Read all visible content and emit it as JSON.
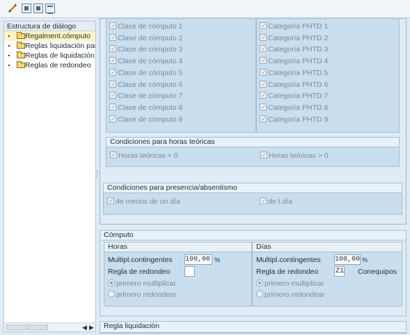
{
  "toolbar": {
    "icons": [
      "pencil-icon",
      "save-icon",
      "save-local-icon",
      "table-icon"
    ]
  },
  "tree": {
    "title": "Estructura de diálogo",
    "items": [
      {
        "label": "Regalment.cómputo",
        "selected": true
      },
      {
        "label": "Reglas liquidación para cc"
      },
      {
        "label": "Reglas de liquidación par."
      },
      {
        "label": "Reglas de redondeo"
      }
    ],
    "scroll_left": "◀",
    "scroll_right": "▶",
    "grip": ":::"
  },
  "clases": {
    "items": [
      "Clase de cómputo 1",
      "Clase de cómputo 2",
      "Clase de cómputo 3",
      "Clase de cómputo 4",
      "Clase de cómputo 5",
      "Clase de cómputo 6",
      "Clase de cómputo 7",
      "Clase de cómputo 8",
      "Clase de cómputo 9"
    ]
  },
  "categorias": {
    "items": [
      "Categoría PHTD 1",
      "Categoría PHTD 2",
      "Categoría PHTD 3",
      "Categoría PHTD 4",
      "Categoría PHTD 5",
      "Categoría PHTD 6",
      "Categoría PHTD 7",
      "Categoría PHTD 8",
      "Categoría PHTD 9"
    ]
  },
  "horas_teoricas": {
    "title": "Condiciones para horas teóricas",
    "opt1": "Horas teóricas = 0",
    "opt2": "Horas teóricas > 0"
  },
  "presencia": {
    "title": "Condiciones para presencia/absentismo",
    "opt1": "de menos de un día",
    "opt2": "de t.día"
  },
  "computo": {
    "title": "Cómputo",
    "horas": {
      "title": "Horas",
      "multipl_label": "Multipl.contingentes",
      "multipl_value": "100,00",
      "unit": "%",
      "redondeo_label": "Regla de redondeo",
      "redondeo_value": "",
      "radio1": "primero multiplicar",
      "radio2": "primero redondear"
    },
    "dias": {
      "title": "Días",
      "multipl_label": "Multipl.contingentes",
      "multipl_value": "100,00",
      "unit": "%",
      "redondeo_label": "Regla de redondeo",
      "redondeo_value": "Z1",
      "redondeo_desc": "Conequipos",
      "radio1": "primero multiplicar",
      "radio2": "primero redondear"
    }
  },
  "regla_liquidacion": {
    "title": "Regla liquidación"
  }
}
